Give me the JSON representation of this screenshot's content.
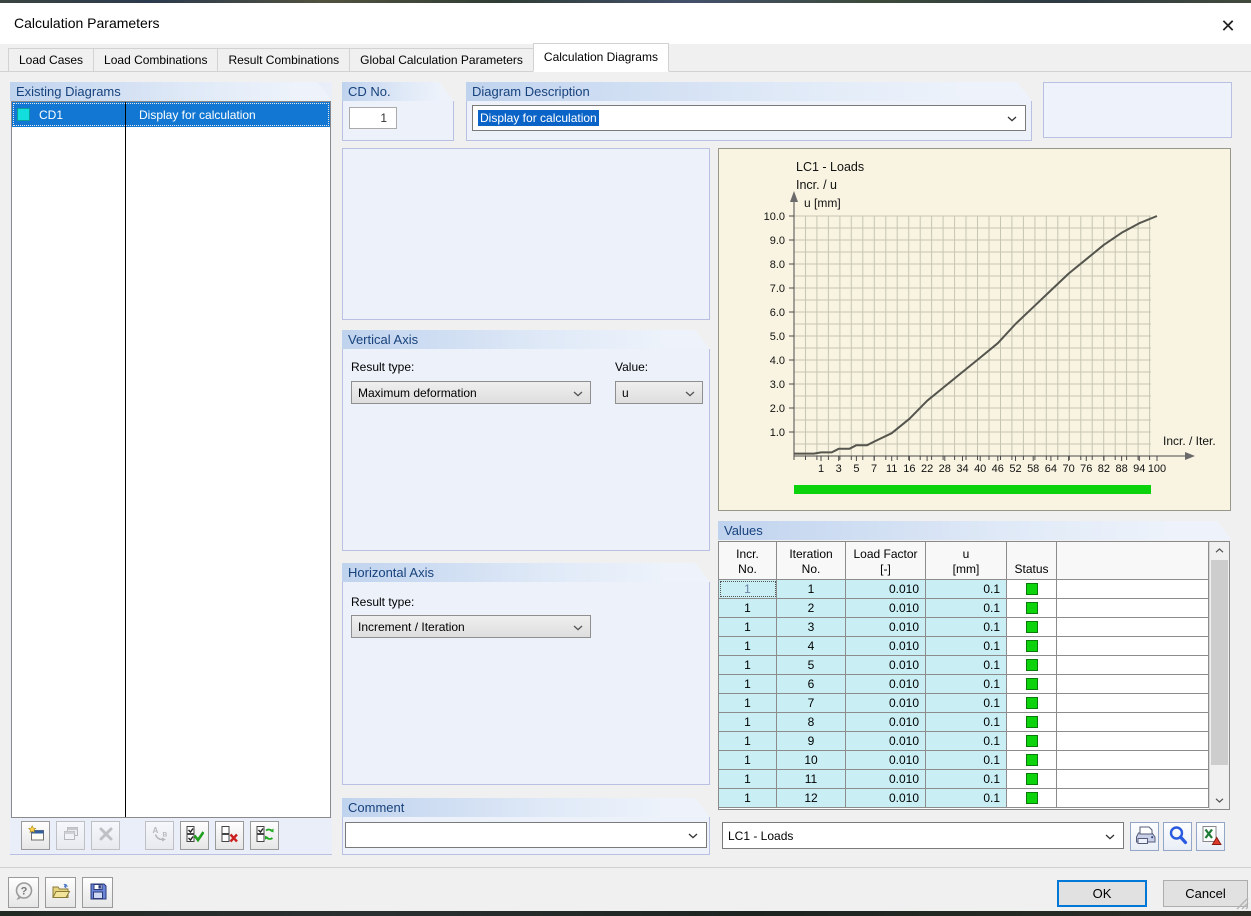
{
  "window": {
    "title": "Calculation Parameters"
  },
  "icons": {
    "close": "✕"
  },
  "tabs": [
    {
      "label": "Load Cases",
      "active": false
    },
    {
      "label": "Load Combinations",
      "active": false
    },
    {
      "label": "Result Combinations",
      "active": false
    },
    {
      "label": "Global Calculation Parameters",
      "active": false
    },
    {
      "label": "Calculation Diagrams",
      "active": true
    }
  ],
  "existing_diagrams": {
    "header": "Existing Diagrams",
    "rows": [
      {
        "name": "CD1",
        "description": "Display for calculation",
        "selected": true,
        "swatch_color": "#12dede"
      }
    ]
  },
  "diagram_toolbar": [
    {
      "name": "new-diagram",
      "enabled": true
    },
    {
      "name": "copy-diagram",
      "enabled": false
    },
    {
      "name": "delete-diagram",
      "enabled": false
    },
    {
      "name": "rename-diagram",
      "enabled": false
    },
    {
      "name": "check-all",
      "enabled": true
    },
    {
      "name": "uncheck-all",
      "enabled": true
    },
    {
      "name": "invert-check",
      "enabled": true
    }
  ],
  "cd_no": {
    "header": "CD No.",
    "value": "1"
  },
  "diagram_description": {
    "header": "Diagram Description",
    "value": "Display for calculation",
    "text_selected": true
  },
  "vertical_axis": {
    "header": "Vertical Axis",
    "result_type_label": "Result type:",
    "result_type_value": "Maximum deformation",
    "value_label": "Value:",
    "value_value": "u"
  },
  "horizontal_axis": {
    "header": "Horizontal Axis",
    "result_type_label": "Result type:",
    "result_type_value": "Increment / Iteration"
  },
  "comment": {
    "header": "Comment",
    "value": ""
  },
  "chart_data": {
    "type": "line",
    "title": "LC1 - Loads",
    "subtitle": "Incr. / u",
    "ylabel": "u [mm]",
    "xlabel": "Incr. / Iter.",
    "ylim": [
      0,
      10
    ],
    "yticks": [
      "10.0",
      "9.0",
      "8.0",
      "7.0",
      "6.0",
      "5.0",
      "4.0",
      "3.0",
      "2.0",
      "1.0"
    ],
    "x_tick_labels": [
      "1",
      "3",
      "5",
      "7",
      "11",
      "16",
      "22",
      "28",
      "34",
      "40",
      "46",
      "52",
      "58",
      "64",
      "70",
      "76",
      "82",
      "88",
      "94",
      "100"
    ],
    "grid": true,
    "background": "#f8f4e1",
    "line_color": "#55554e",
    "series": [
      {
        "name": "u",
        "x": [
          1,
          3,
          5,
          7,
          11,
          16,
          22,
          28,
          34,
          40,
          46,
          52,
          58,
          64,
          70,
          76,
          82,
          88,
          94,
          100
        ],
        "values": [
          0.15,
          0.3,
          0.45,
          0.6,
          0.95,
          1.55,
          2.3,
          2.9,
          3.5,
          4.1,
          4.7,
          5.5,
          6.2,
          6.9,
          7.6,
          8.2,
          8.8,
          9.3,
          9.7,
          10.0
        ],
        "origin_value": 0.1
      }
    ],
    "progress_bar": {
      "color": "#0bd30b"
    }
  },
  "values": {
    "header": "Values",
    "columns": [
      {
        "line1": "Incr.",
        "line2": "No."
      },
      {
        "line1": "Iteration",
        "line2": "No."
      },
      {
        "line1": "Load Factor",
        "line2": "[-]"
      },
      {
        "line1": "u",
        "line2": "[mm]"
      },
      {
        "line1": "",
        "line2": "Status"
      },
      {
        "line1": "",
        "line2": ""
      }
    ],
    "rows": [
      {
        "incr": "1",
        "iter": "1",
        "load_factor": "0.010",
        "u": "0.1",
        "status": "green"
      },
      {
        "incr": "1",
        "iter": "2",
        "load_factor": "0.010",
        "u": "0.1",
        "status": "green"
      },
      {
        "incr": "1",
        "iter": "3",
        "load_factor": "0.010",
        "u": "0.1",
        "status": "green"
      },
      {
        "incr": "1",
        "iter": "4",
        "load_factor": "0.010",
        "u": "0.1",
        "status": "green"
      },
      {
        "incr": "1",
        "iter": "5",
        "load_factor": "0.010",
        "u": "0.1",
        "status": "green"
      },
      {
        "incr": "1",
        "iter": "6",
        "load_factor": "0.010",
        "u": "0.1",
        "status": "green"
      },
      {
        "incr": "1",
        "iter": "7",
        "load_factor": "0.010",
        "u": "0.1",
        "status": "green"
      },
      {
        "incr": "1",
        "iter": "8",
        "load_factor": "0.010",
        "u": "0.1",
        "status": "green"
      },
      {
        "incr": "1",
        "iter": "9",
        "load_factor": "0.010",
        "u": "0.1",
        "status": "green"
      },
      {
        "incr": "1",
        "iter": "10",
        "load_factor": "0.010",
        "u": "0.1",
        "status": "green"
      },
      {
        "incr": "1",
        "iter": "11",
        "load_factor": "0.010",
        "u": "0.1",
        "status": "green"
      },
      {
        "incr": "1",
        "iter": "12",
        "load_factor": "0.010",
        "u": "0.1",
        "status": "green"
      }
    ]
  },
  "lc_selector": {
    "value": "LC1 - Loads"
  },
  "values_toolbar": [
    {
      "name": "print",
      "enabled": true
    },
    {
      "name": "zoom",
      "enabled": true
    },
    {
      "name": "export-excel",
      "enabled": true
    }
  ],
  "footer_toolbar": [
    {
      "name": "help",
      "enabled": true
    },
    {
      "name": "open",
      "enabled": true
    },
    {
      "name": "save",
      "enabled": true
    }
  ],
  "buttons": {
    "ok": "OK",
    "cancel": "Cancel"
  }
}
